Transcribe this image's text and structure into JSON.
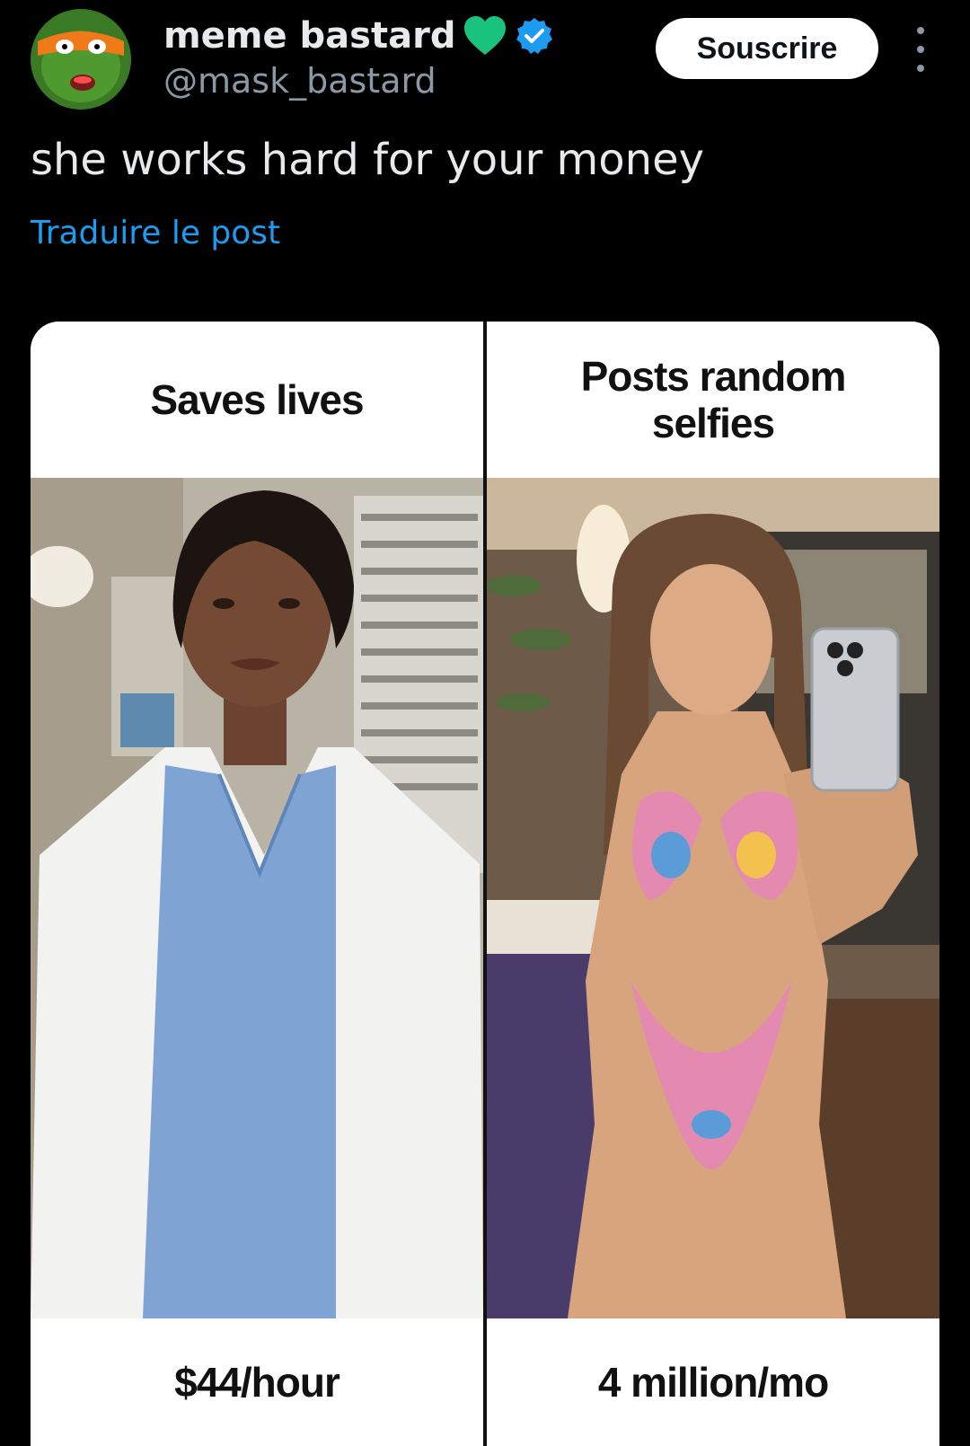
{
  "author": {
    "display_name": "meme bastard",
    "handle": "@mask_bastard",
    "heart_color": "#19c37d",
    "verified_color": "#1d9bf0"
  },
  "actions": {
    "subscribe_label": "Souscrire"
  },
  "post": {
    "text": "she works hard for your money",
    "translate_label": "Traduire le post"
  },
  "meme": {
    "left_header": "Saves lives",
    "right_header": "Posts random selfies",
    "left_footer": "$44/hour",
    "right_footer": "4 million/mo"
  },
  "icons": {
    "avatar": "turtle-mask-avatar",
    "heart": "green-heart-icon",
    "verified": "verified-badge-icon",
    "more": "more-options-icon"
  }
}
